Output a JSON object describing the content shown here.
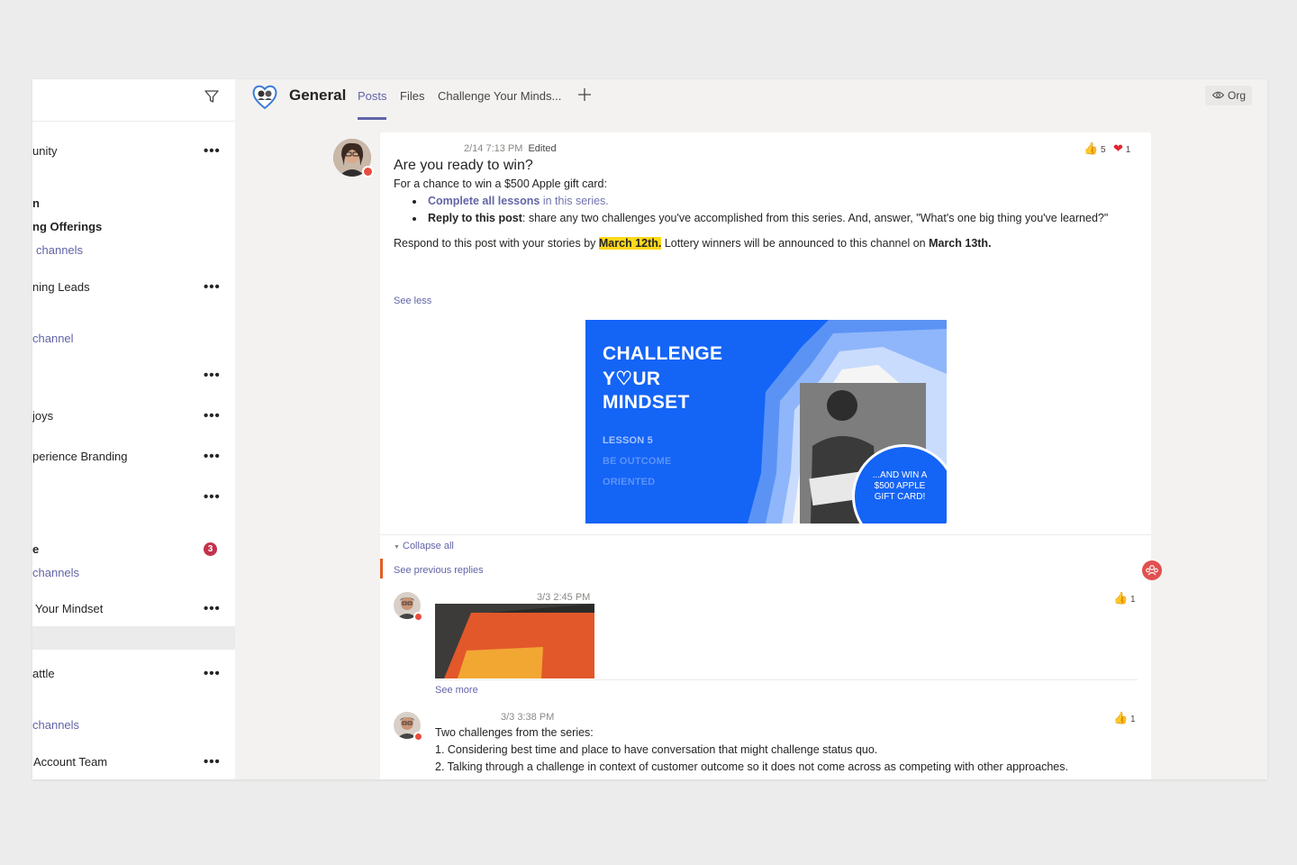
{
  "sidebar": {
    "items": [
      {
        "label": "unity",
        "more": "•••"
      },
      {
        "label": "n"
      },
      {
        "label": "ng Offerings"
      },
      {
        "label": "channels"
      },
      {
        "label": "ning Leads",
        "more": "•••"
      },
      {
        "label": "channel"
      },
      {
        "label": "",
        "more": "•••"
      },
      {
        "label": "joys",
        "more": "•••"
      },
      {
        "label": "perience Branding",
        "more": "•••"
      },
      {
        "label": "",
        "more": "•••"
      },
      {
        "label": "e",
        "badge": "3"
      },
      {
        "label": "channels"
      },
      {
        "label": "Your Mindset",
        "more": "•••"
      },
      {
        "label": "attle",
        "more": "•••"
      },
      {
        "label": "channels"
      },
      {
        "label": "Account Team",
        "more": "•••"
      }
    ]
  },
  "header": {
    "title": "General",
    "tabs": [
      "Posts",
      "Files",
      "Challenge Your Minds..."
    ],
    "org_label": "Org"
  },
  "post": {
    "timestamp": "2/14 7:13 PM",
    "edited": "Edited",
    "title": "Are you ready to win?",
    "intro": "For a chance to win a $500 Apple gift card:",
    "bullet1_bold": "Complete all lessons",
    "bullet1_rest": " in this series.",
    "bullet2_bold": "Reply to this post",
    "bullet2_rest": ": share any two challenges you've accomplished from this series. And, answer, \"What's one big thing you've learned?\"",
    "respond_1": "Respond to this post with your stories by ",
    "respond_highlight": "March 12th.",
    "respond_2": " Lottery winners will be announced to this channel on ",
    "respond_bold": "March 13th.",
    "see_less": "See less",
    "reactions": {
      "like_count": "5",
      "heart_count": "1"
    },
    "banner": {
      "line1": "CHALLENGE",
      "line2": "Y♡UR",
      "line3": "MINDSET",
      "lesson": "LESSON 5",
      "sub1": "BE OUTCOME",
      "sub2": "ORIENTED",
      "circle_text": "...AND WIN A $500 APPLE GIFT CARD!"
    }
  },
  "replies": {
    "collapse_all": "Collapse all",
    "see_previous": "See previous replies",
    "reply1": {
      "timestamp": "3/3 2:45 PM",
      "see_more": "See more",
      "like_count": "1"
    },
    "reply2": {
      "timestamp": "3/3 3:38 PM",
      "like_count": "1",
      "line1": "Two challenges from the series:",
      "line2": "1. Considering best time and place to have conversation that might challenge status quo.",
      "line3": "2. Talking through a challenge in context of customer outcome so it does not come across as competing with other approaches."
    }
  },
  "colors": {
    "accent": "#6264a7",
    "banner_blue": "#1464f6",
    "highlight": "#ffd81b",
    "badge": "#c4314b"
  }
}
